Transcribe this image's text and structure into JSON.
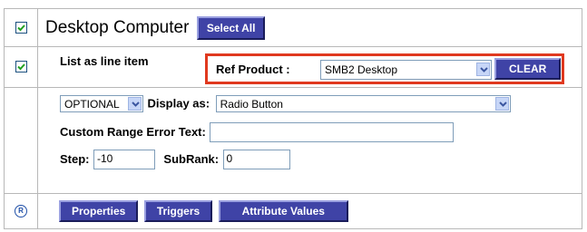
{
  "product": {
    "title": "Desktop Computer",
    "select_all_label": "Select All",
    "checked": true
  },
  "line_item": {
    "checkbox_label": "List as line item",
    "checked": true,
    "ref_product_label": "Ref Product :",
    "ref_product_value": "SMB2 Desktop",
    "clear_label": "CLEAR"
  },
  "options": {
    "optional_value": "OPTIONAL",
    "display_as_label": "Display as:",
    "display_as_value": "Radio Button",
    "custom_range_label": "Custom Range Error Text:",
    "custom_range_value": "",
    "step_label": "Step:",
    "step_value": "-10",
    "subrank_label": "SubRank:",
    "subrank_value": "0"
  },
  "actions": {
    "radio_symbol": "R",
    "properties_label": "Properties",
    "triggers_label": "Triggers",
    "attribute_values_label": "Attribute Values"
  },
  "colors": {
    "button_bg": "#3f43a6",
    "highlight_border": "#e0391f"
  }
}
